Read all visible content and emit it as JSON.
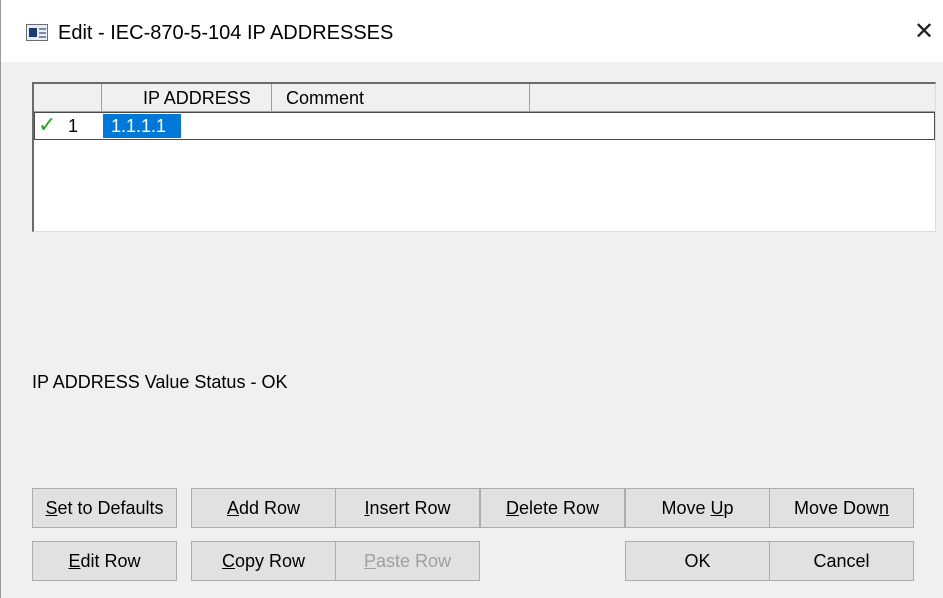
{
  "window": {
    "title": "Edit - IEC-870-5-104 IP ADDRESSES",
    "icon": "window-app-icon",
    "close_glyph": "✕"
  },
  "grid": {
    "columns": [
      "",
      "IP ADDRESS",
      "Comment",
      ""
    ],
    "rows": [
      {
        "status_icon": "✓",
        "number": "1",
        "ip_address": "1.1.1.1",
        "comment": ""
      }
    ]
  },
  "status_text": "IP ADDRESS Value Status - OK",
  "buttons": {
    "set_defaults": {
      "pre": "",
      "key": "S",
      "post": "et to Defaults"
    },
    "add_row": {
      "pre": "",
      "key": "A",
      "post": "dd Row"
    },
    "insert_row": {
      "pre": "",
      "key": "I",
      "post": "nsert Row"
    },
    "delete_row": {
      "pre": "",
      "key": "D",
      "post": "elete Row"
    },
    "move_up": {
      "pre": "Move ",
      "key": "U",
      "post": "p"
    },
    "move_down": {
      "pre": "Move Dow",
      "key": "n",
      "post": ""
    },
    "edit_row": {
      "pre": "",
      "key": "E",
      "post": "dit Row"
    },
    "copy_row": {
      "pre": "",
      "key": "C",
      "post": "opy Row"
    },
    "paste_row": {
      "pre": "",
      "key": "P",
      "post": "aste Row"
    },
    "ok": "OK",
    "cancel": "Cancel"
  },
  "colors": {
    "selection": "#0078d7",
    "check": "#2aa52a",
    "disabled_text": "#a0a0a0"
  }
}
